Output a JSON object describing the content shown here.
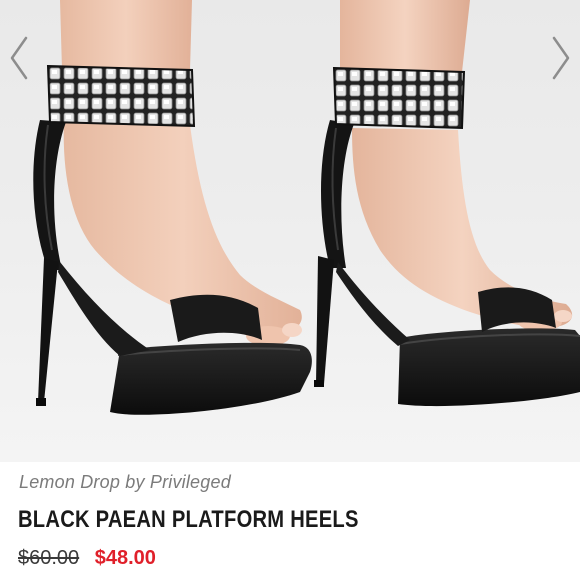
{
  "listing": {
    "brand_line": "Lemon Drop by Privileged",
    "title": "BLACK PAEAN PLATFORM HEELS",
    "original_price": "$60.00",
    "sale_price": "$48.00"
  },
  "photo": {
    "subject": "product-photo",
    "prev_icon": "chevron-left-icon",
    "next_icon": "chevron-right-icon"
  },
  "colors": {
    "shoe": "#151515",
    "rhinestone": "#dcdcdc",
    "skin": "#efc7b0",
    "sale_price": "#e0202a",
    "brand_text": "#7b7b7b",
    "background": "#ececec"
  }
}
